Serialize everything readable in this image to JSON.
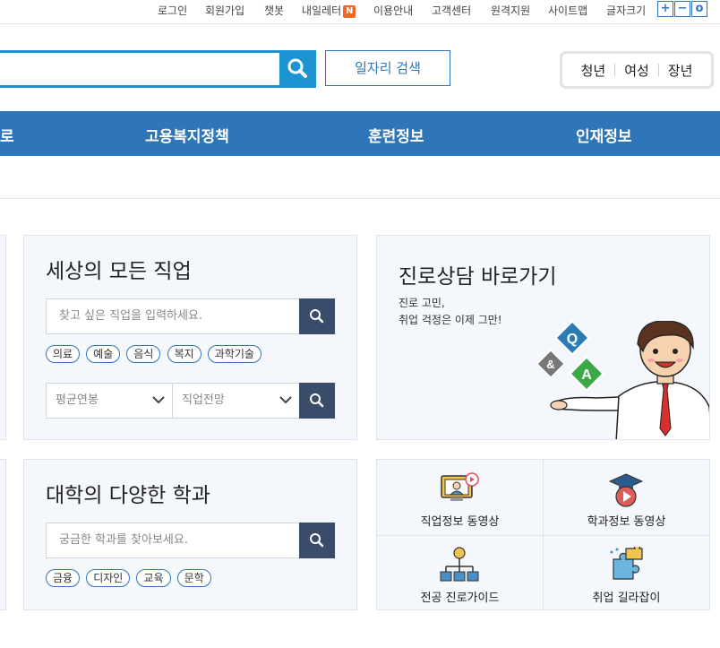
{
  "utility_bar": {
    "items": [
      "로그인",
      "회원가입",
      "챗봇",
      "내일레터",
      "이용안내",
      "고객센터",
      "원격지원",
      "사이트맵",
      "글자크기"
    ],
    "new_badge": "N",
    "font_size_buttons": [
      "+",
      "−",
      "o"
    ]
  },
  "search": {
    "value": "",
    "job_search_label": "일자리 검색",
    "target_groups": [
      "청년",
      "여성",
      "장년"
    ]
  },
  "nav": {
    "items": [
      "로",
      "고용복지정책",
      "훈련정보",
      "인재정보"
    ]
  },
  "jobs_panel": {
    "title": "세상의 모든 직업",
    "search_placeholder": "찾고 싶은 직업을 입력하세요.",
    "tags": [
      "의료",
      "예술",
      "음식",
      "복지",
      "과학기술"
    ],
    "select_salary": "평균연봉",
    "select_outlook": "직업전망"
  },
  "counsel_panel": {
    "title": "진로상담 바로가기",
    "line1": "진로 고민,",
    "line2": "취업 걱정은 이제 그만!",
    "qa_letters": [
      "Q",
      "&",
      "A"
    ]
  },
  "majors_panel": {
    "title": "대학의 다양한 학과",
    "search_placeholder": "궁금한 학과를 찾아보세요.",
    "tags": [
      "금융",
      "디자인",
      "교육",
      "문학"
    ]
  },
  "shortcuts": {
    "items": [
      "직업정보 동영상",
      "학과정보 동영상",
      "전공 진로가이드",
      "취업 길라잡이"
    ]
  },
  "colors": {
    "primary": "#2e76b9",
    "search_blue": "#1c94d2",
    "dark_button": "#3b4b6a",
    "badge": "#f26722",
    "panel_bg": "#f4f7fb",
    "qa_blue": "#2c7bb5",
    "qa_gray": "#777777",
    "qa_green": "#3aa845"
  }
}
